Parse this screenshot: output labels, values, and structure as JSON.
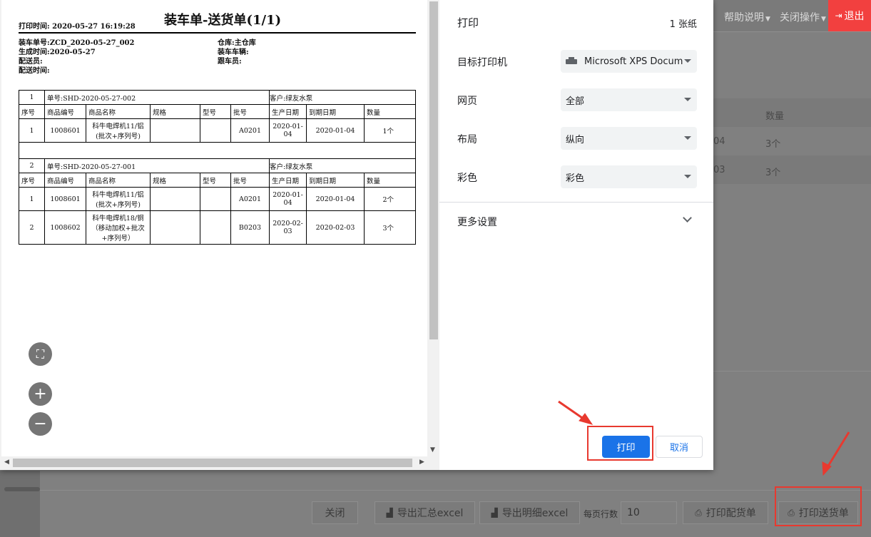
{
  "app": {
    "menus": {
      "help": "帮助说明",
      "close_ops": "关闭操作",
      "exit": "退出"
    },
    "bg_table": {
      "header_qty": "数量",
      "rows": [
        {
          "date_frag": "04",
          "qty": "3个"
        },
        {
          "date_frag": "03",
          "qty": "3个"
        }
      ]
    },
    "footer": {
      "close": "关闭",
      "export_summary": "导出汇总excel",
      "export_detail": "导出明细excel",
      "rows_per_page_label": "每页行数",
      "rows_per_page_value": "10",
      "print_picking": "打印配货单",
      "print_delivery": "打印送货单"
    },
    "colors": {
      "exit_bg": "#f2403f",
      "primary": "#1a73e8",
      "annotation": "#e8392f"
    }
  },
  "print_dialog": {
    "title": "打印",
    "sheet_count": "1 张纸",
    "settings": [
      {
        "label": "目标打印机",
        "value": "Microsoft XPS Docum",
        "icon": "printer-icon"
      },
      {
        "label": "网页",
        "value": "全部"
      },
      {
        "label": "布局",
        "value": "纵向"
      },
      {
        "label": "彩色",
        "value": "彩色"
      }
    ],
    "more_settings": "更多设置",
    "print_button": "打印",
    "cancel_button": "取消"
  },
  "document": {
    "title": "装车单-送货单(1/1)",
    "print_time": "打印时间: 2020-05-27 16:19:28",
    "info_left": [
      "装车单号:ZCD_2020-05-27_002",
      "生成时间:2020-05-27",
      "配送员:",
      "配送时间:"
    ],
    "info_right": [
      "仓库:主仓库",
      "装车车辆:",
      "跟车员:"
    ],
    "columns": [
      "序号",
      "商品编号",
      "商品名称",
      "规格",
      "型号",
      "批号",
      "生产日期",
      "到期日期",
      "数量"
    ],
    "orders": [
      {
        "seq": "1",
        "order_no": "单号:SHD-2020-05-27-002",
        "customer": "客户:绿友水泵",
        "items": [
          {
            "seq": "1",
            "code": "1008601",
            "name": "科牛电焊机11/铝(批次+序列号)",
            "spec": "",
            "model": "",
            "batch": "A0201",
            "mfg": "2020-01-04",
            "exp": "2020-01-04",
            "qty": "1个"
          }
        ]
      },
      {
        "seq": "2",
        "order_no": "单号:SHD-2020-05-27-001",
        "customer": "客户:绿友水泵",
        "items": [
          {
            "seq": "1",
            "code": "1008601",
            "name": "科牛电焊机11/铝(批次+序列号)",
            "spec": "",
            "model": "",
            "batch": "A0201",
            "mfg": "2020-01-04",
            "exp": "2020-01-04",
            "qty": "2个"
          },
          {
            "seq": "2",
            "code": "1008602",
            "name": "科牛电焊机18/铜（移动加权+批次+序列号）",
            "spec": "",
            "model": "",
            "batch": "B0203",
            "mfg": "2020-02-03",
            "exp": "2020-02-03",
            "qty": "3个"
          }
        ]
      }
    ]
  },
  "zoom_controls": {
    "fit": "⛶",
    "zoom_in": "+",
    "zoom_out": "−"
  }
}
